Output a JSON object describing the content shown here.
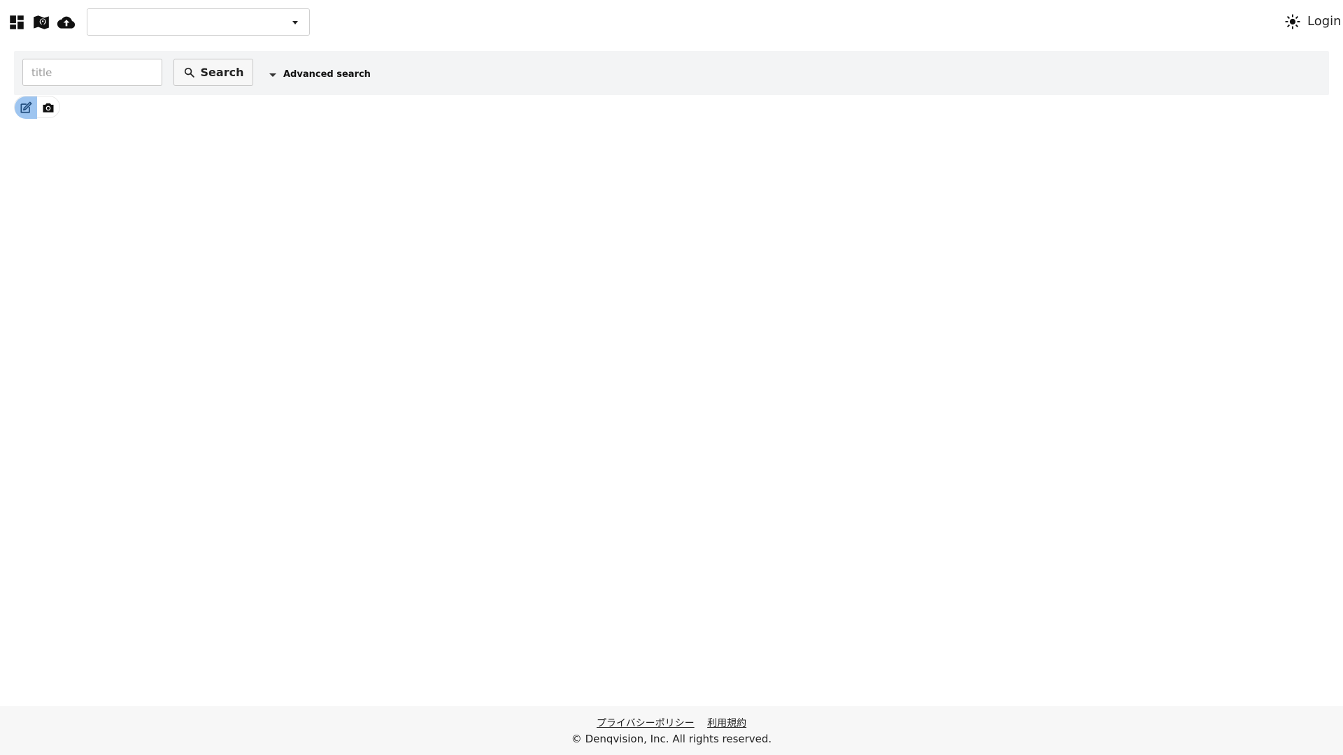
{
  "topbar": {
    "icons": [
      "dashboard-icon",
      "map-icon",
      "cloud-upload-icon"
    ],
    "project_select": {
      "value": ""
    },
    "theme_icon": "sun-icon",
    "login_label": "Login"
  },
  "search": {
    "title_placeholder": "title",
    "title_value": "",
    "search_label": "Search",
    "advanced_label": "Advanced search"
  },
  "mode_toggle": {
    "items": [
      "edit-icon",
      "camera-icon"
    ],
    "active": "edit-icon",
    "active_color": "#9ec5f0"
  },
  "footer": {
    "privacy_label": "プライバシーポリシー",
    "terms_label": "利用規約",
    "copyright": "© Denqvision, Inc. All rights reserved."
  }
}
